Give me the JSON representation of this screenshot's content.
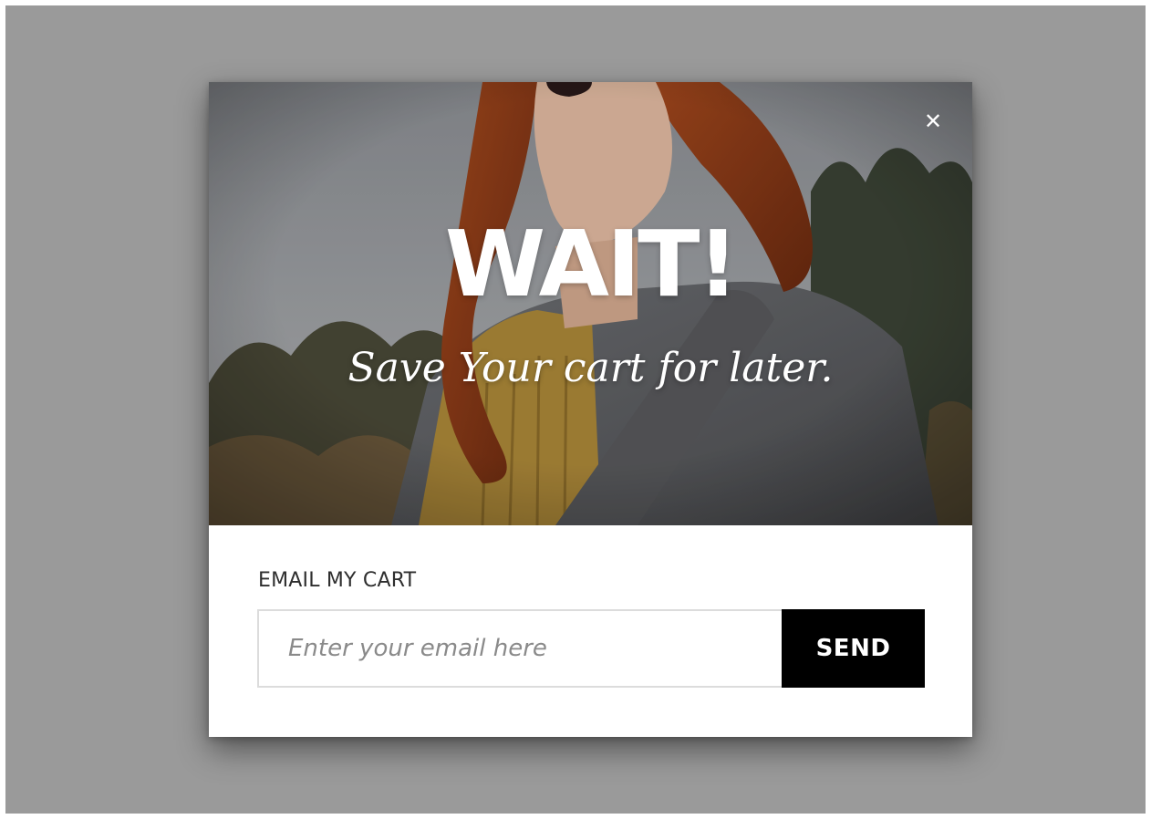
{
  "popup": {
    "close_icon": "close-icon",
    "headline": "WAIT!",
    "subheadline": "Save Your cart for later.",
    "form_label": "EMAIL MY CART",
    "email_placeholder": "Enter your email here",
    "email_value": "",
    "send_label": "SEND"
  },
  "colors": {
    "backdrop": "#9a9a9a",
    "button_bg": "#000000",
    "button_text": "#ffffff",
    "label_text": "#2e2e2e"
  }
}
